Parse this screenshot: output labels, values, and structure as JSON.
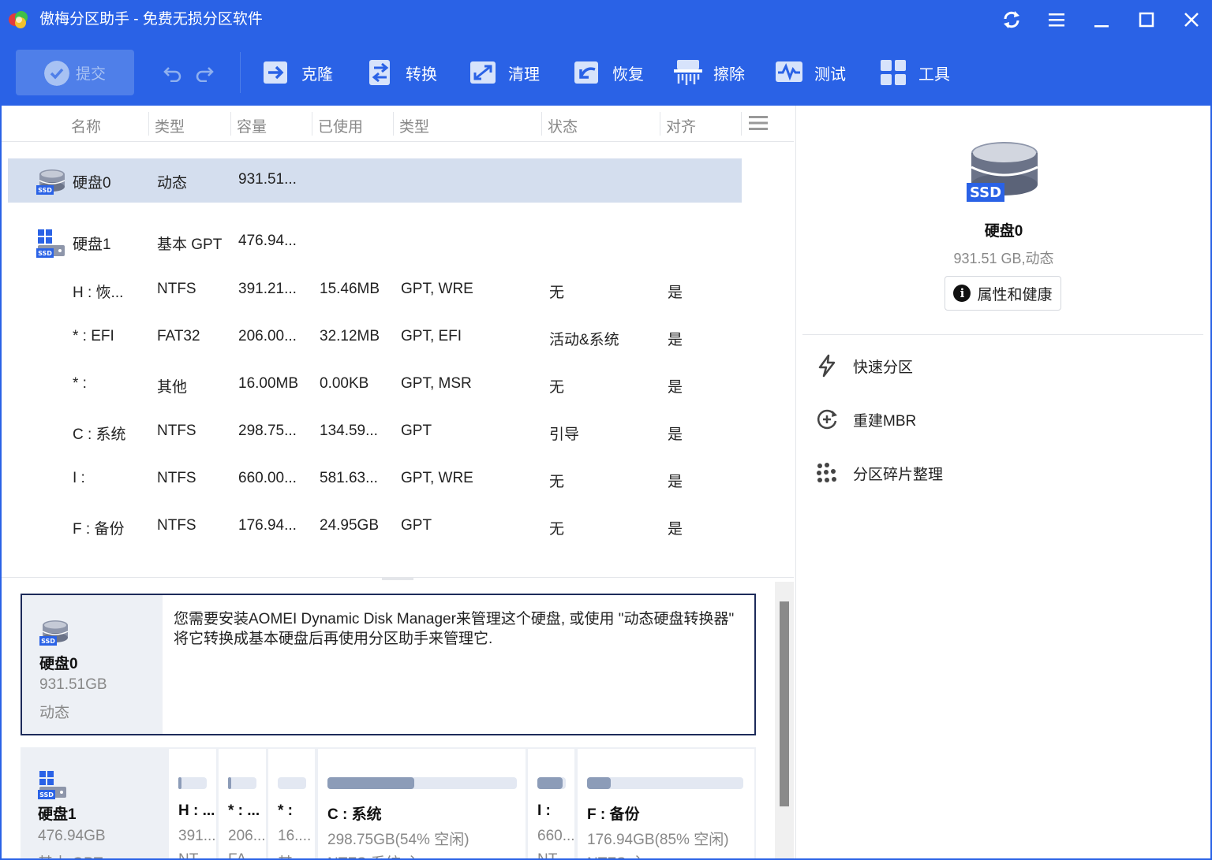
{
  "app": {
    "title": "傲梅分区助手 - 免费无损分区软件"
  },
  "toolbar": {
    "submit": "提交",
    "items": [
      {
        "label": "克隆",
        "icon": "clone-icon"
      },
      {
        "label": "转换",
        "icon": "convert-icon"
      },
      {
        "label": "清理",
        "icon": "clean-icon"
      },
      {
        "label": "恢复",
        "icon": "recover-icon"
      },
      {
        "label": "擦除",
        "icon": "wipe-icon"
      },
      {
        "label": "测试",
        "icon": "test-icon"
      },
      {
        "label": "工具",
        "icon": "tools-icon"
      }
    ]
  },
  "table": {
    "headers": [
      "名称",
      "类型",
      "容量",
      "已使用",
      "类型",
      "状态",
      "对齐"
    ],
    "disks": [
      {
        "name": "硬盘0",
        "type": "动态",
        "capacity": "931.51..."
      },
      {
        "name": "硬盘1",
        "type": "基本 GPT",
        "capacity": "476.94..."
      }
    ],
    "partitions": [
      {
        "name": "H : 恢...",
        "fs": "NTFS",
        "capacity": "391.21...",
        "used": "15.46MB",
        "ptype": "GPT, WRE",
        "status": "无",
        "align": "是"
      },
      {
        "name": "* : EFI",
        "fs": "FAT32",
        "capacity": "206.00...",
        "used": "32.12MB",
        "ptype": "GPT, EFI",
        "status": "活动&系统",
        "align": "是"
      },
      {
        "name": "* :",
        "fs": "其他",
        "capacity": "16.00MB",
        "used": "0.00KB",
        "ptype": "GPT, MSR",
        "status": "无",
        "align": "是"
      },
      {
        "name": "C : 系统",
        "fs": "NTFS",
        "capacity": "298.75...",
        "used": "134.59...",
        "ptype": "GPT",
        "status": "引导",
        "align": "是"
      },
      {
        "name": "I :",
        "fs": "NTFS",
        "capacity": "660.00...",
        "used": "581.63...",
        "ptype": "GPT, WRE",
        "status": "无",
        "align": "是"
      },
      {
        "name": "F : 备份",
        "fs": "NTFS",
        "capacity": "176.94...",
        "used": "24.95GB",
        "ptype": "GPT",
        "status": "无",
        "align": "是"
      }
    ]
  },
  "card0": {
    "name": "硬盘0",
    "size": "931.51GB",
    "type": "动态",
    "message": "您需要安装AOMEI Dynamic Disk Manager来管理这个硬盘, 或使用 \"动态硬盘转换器\" 将它转换成基本硬盘后再使用分区助手来管理它."
  },
  "card1": {
    "name": "硬盘1",
    "size": "476.94GB",
    "type": "基本 GPT",
    "parts": [
      {
        "name": "H : ...",
        "size": "391...",
        "type": "NT...",
        "fill": 0.1
      },
      {
        "name": "* : ...",
        "size": "206...",
        "type": "FA...",
        "fill": 0.1
      },
      {
        "name": "* :",
        "size": "16....",
        "type": "其...",
        "fill": 0.0
      },
      {
        "name": "C : 系统",
        "size": "298.75GB(54% 空闲)",
        "type": "NTFS,系统,主",
        "fill": 0.46
      },
      {
        "name": "I :",
        "size": "660...",
        "type": "NT...",
        "fill": 0.88
      },
      {
        "name": "F : 备份",
        "size": "176.94GB(85% 空闲)",
        "type": "NTFS,主",
        "fill": 0.15
      }
    ]
  },
  "right": {
    "disk_name": "硬盘0",
    "disk_sub": "931.51 GB,动态",
    "props_button": "属性和健康",
    "ops": [
      {
        "label": "快速分区",
        "icon": "lightning-icon"
      },
      {
        "label": "重建MBR",
        "icon": "rebuild-mbr-icon"
      },
      {
        "label": "分区碎片整理",
        "icon": "defrag-icon"
      }
    ]
  },
  "colors": {
    "brand": "#2a62e6",
    "selected_row": "#d4deee",
    "card_border": "#1d2b5a"
  }
}
